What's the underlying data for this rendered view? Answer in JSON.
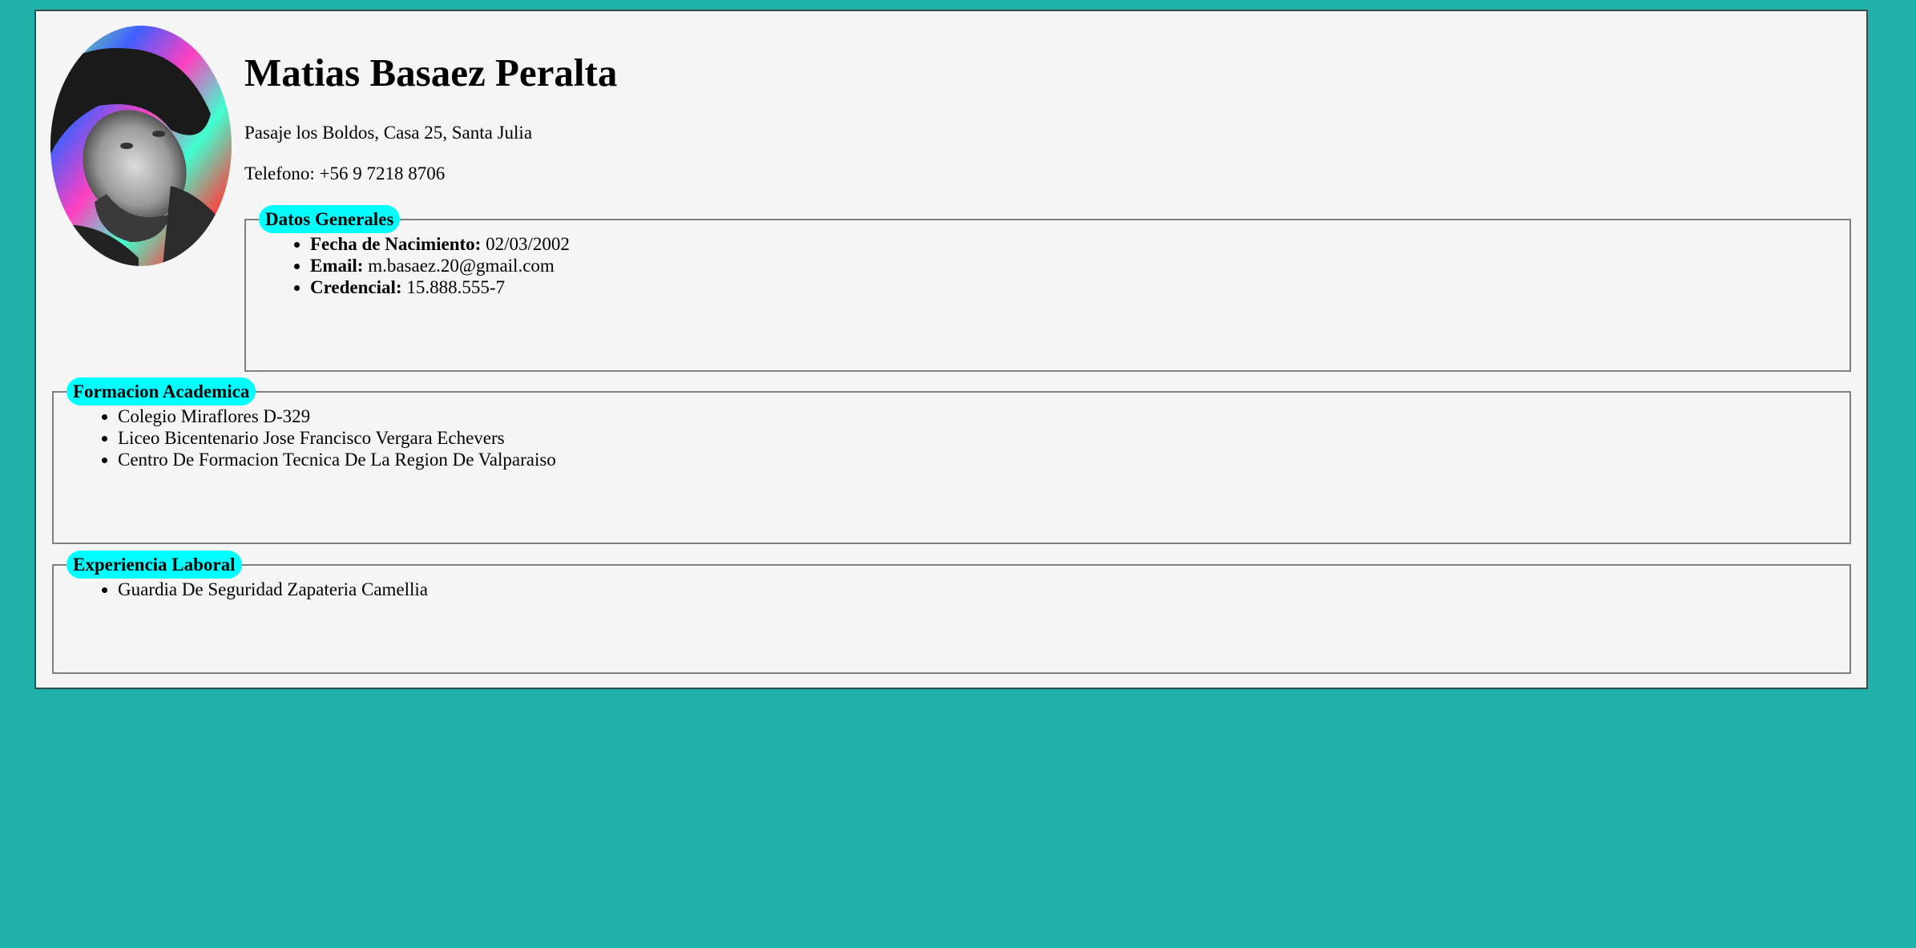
{
  "profile": {
    "name": "Matias Basaez Peralta",
    "address": "Pasaje los Boldos, Casa 25, Santa Julia",
    "phone": "Telefono: +56 9 7218 8706"
  },
  "datos_generales": {
    "legend": "Datos Generales",
    "items": [
      {
        "label": "Fecha de Nacimiento:",
        "value": "02/03/2002"
      },
      {
        "label": "Email:",
        "value": "m.basaez.20@gmail.com"
      },
      {
        "label": "Credencial:",
        "value": "15.888.555-7"
      }
    ]
  },
  "formacion_academica": {
    "legend": "Formacion Academica",
    "items": [
      "Colegio Miraflores D-329",
      "Liceo Bicentenario Jose Francisco Vergara Echevers",
      "Centro De Formacion Tecnica De La Region De Valparaiso"
    ]
  },
  "experiencia_laboral": {
    "legend": "Experiencia Laboral",
    "items": [
      "Guardia De Seguridad Zapateria Camellia"
    ]
  },
  "colors": {
    "page_background": "#20b2aa",
    "card_background": "#f5f5f5",
    "legend_background": "#00ffff",
    "fieldset_border": "#808080"
  }
}
